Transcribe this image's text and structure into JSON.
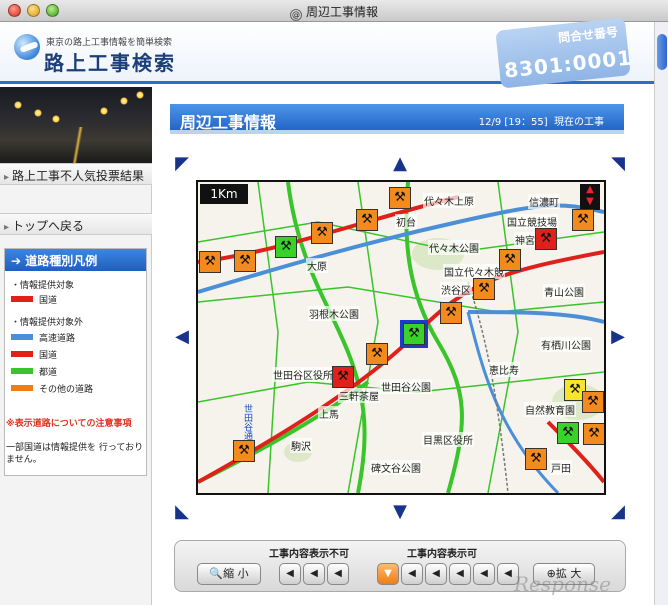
{
  "window": {
    "title": "周辺工事情報"
  },
  "header": {
    "tagline": "東京の路上工事情報を簡単検索",
    "site_title": "路上工事検索",
    "inquiry_label": "問合せ番号",
    "inquiry_number": "8301:0001"
  },
  "sidebar": {
    "vote_link": "路上工事不人気投票結果",
    "back_link": "トップへ戻る",
    "legend": {
      "title": "道路種別凡例",
      "provided_heading": "・情報提供対象",
      "provided": [
        {
          "label": "国道",
          "color": "#e0201a"
        }
      ],
      "not_provided_heading": "・情報提供対象外",
      "not_provided": [
        {
          "label": "高速道路",
          "color": "#4a8fd8"
        },
        {
          "label": "国道",
          "color": "#e0201a"
        },
        {
          "label": "都道",
          "color": "#39c42a"
        },
        {
          "label": "その他の道路",
          "color": "#f07d14"
        }
      ],
      "note_title": "※表示道路についての注意事項",
      "note_text": "一部国道は情報提供を 行っておりません。"
    }
  },
  "main": {
    "title": "周辺工事情報",
    "datetime": "12/9 [19：55]",
    "status": "現在の工事"
  },
  "map": {
    "scale": "1Km",
    "compass_icon": "compass-north-icon",
    "places": [
      "代々木上原",
      "代々木公園",
      "国立代々木競",
      "国立競技場",
      "信濃町",
      "初台",
      "大原",
      "羽根木公園",
      "渋谷区",
      "神宮",
      "青山公園",
      "有栖川公園",
      "世田谷区役所",
      "三軒茶屋",
      "世田谷公園",
      "恵比寿",
      "自然教育園",
      "目黒区役所",
      "碑文谷公園",
      "戸田",
      "駒沢",
      "上馬",
      "世田谷通り"
    ],
    "markers": [
      {
        "color": "orange"
      },
      {
        "color": "orange"
      },
      {
        "color": "orange"
      },
      {
        "color": "green"
      },
      {
        "color": "orange"
      },
      {
        "color": "orange"
      },
      {
        "color": "orange"
      },
      {
        "color": "red"
      },
      {
        "color": "orange"
      },
      {
        "color": "orange"
      },
      {
        "color": "orange"
      },
      {
        "color": "orange"
      },
      {
        "color": "green",
        "selected": true
      },
      {
        "color": "orange"
      },
      {
        "color": "red"
      },
      {
        "color": "yellow"
      },
      {
        "color": "green"
      },
      {
        "color": "orange"
      },
      {
        "color": "orange"
      },
      {
        "color": "orange"
      }
    ]
  },
  "controls": {
    "hide_label": "工事内容表示不可",
    "show_label": "工事内容表示可",
    "zoom_out": "縮 小",
    "zoom_in": "拡 大",
    "zoom_out_icon": "magnifier-minus-icon",
    "zoom_in_icon": "magnifier-plus-icon"
  },
  "watermark": "Response"
}
